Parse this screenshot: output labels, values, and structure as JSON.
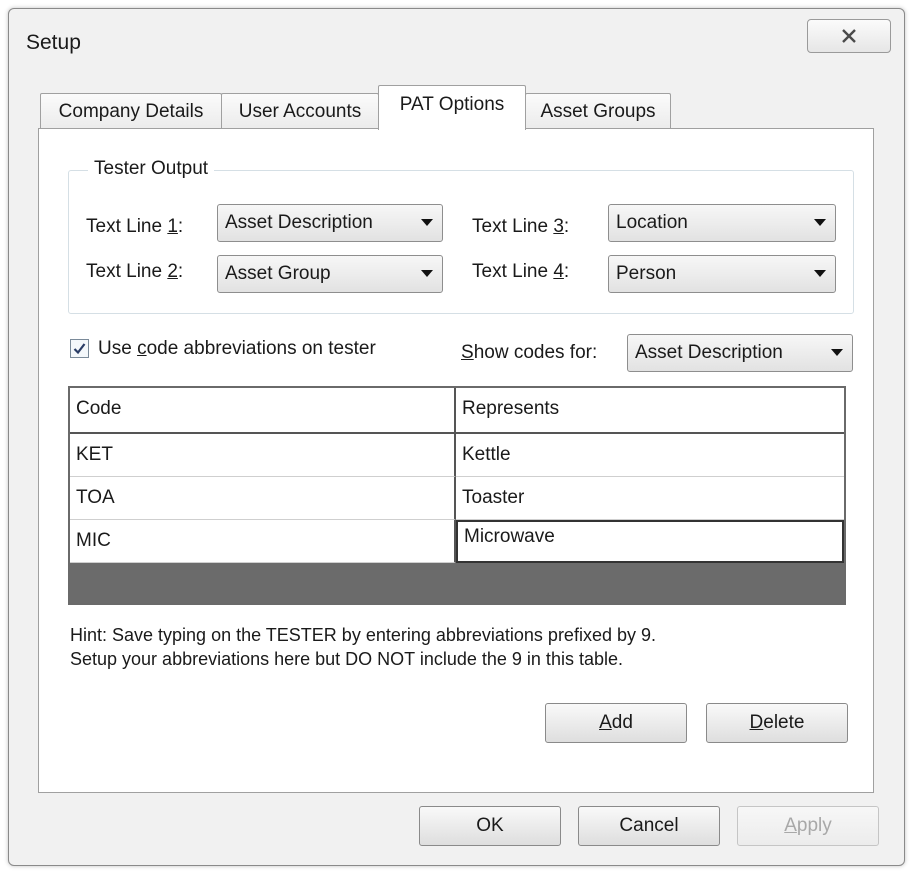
{
  "window": {
    "title": "Setup"
  },
  "tabs": [
    {
      "label": "Company Details",
      "active": false
    },
    {
      "label": "User Accounts",
      "active": false
    },
    {
      "label": "PAT Options",
      "active": true
    },
    {
      "label": "Asset Groups",
      "active": false
    }
  ],
  "tester_output": {
    "title": "Tester Output",
    "lines": [
      {
        "label_pre": "Text Line ",
        "mnemonic": "1",
        "label_post": ":",
        "value": "Asset Description"
      },
      {
        "label_pre": "Text Line ",
        "mnemonic": "2",
        "label_post": ":",
        "value": "Asset Group"
      },
      {
        "label_pre": "Text Line ",
        "mnemonic": "3",
        "label_post": ":",
        "value": "Location"
      },
      {
        "label_pre": "Text Line ",
        "mnemonic": "4",
        "label_post": ":",
        "value": "Person"
      }
    ]
  },
  "abbreviations": {
    "checkbox_pre": "Use ",
    "checkbox_mnemonic": "c",
    "checkbox_post": "ode abbreviations on tester",
    "checked": true,
    "show_codes_mnemonic": "S",
    "show_codes_post": "how codes for:",
    "show_codes_value": "Asset Description"
  },
  "table": {
    "columns": [
      "Code",
      "Represents"
    ],
    "rows": [
      {
        "code": "KET",
        "represents": "Kettle"
      },
      {
        "code": "TOA",
        "represents": "Toaster"
      },
      {
        "code": "MIC",
        "represents": "Microwave"
      }
    ]
  },
  "hint": {
    "line1": "Hint: Save typing on the TESTER by entering abbreviations prefixed by 9.",
    "line2": "Setup your abbreviations here but DO NOT include the 9 in this table."
  },
  "buttons": {
    "add_mnemonic": "A",
    "add_post": "dd",
    "delete_mnemonic": "D",
    "delete_post": "elete",
    "ok": "OK",
    "cancel": "Cancel",
    "apply_mnemonic": "A",
    "apply_post": "pply"
  },
  "colors": {
    "dialog_bg": "#f1f1f1",
    "panel_bg": "#ffffff",
    "grid_empty": "#6b6b6b"
  }
}
